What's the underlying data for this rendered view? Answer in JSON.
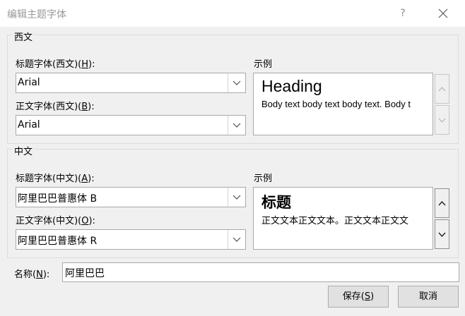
{
  "window": {
    "title": "编辑主题字体",
    "help_label": "?"
  },
  "western": {
    "group_title": "西文",
    "heading_font": {
      "label_before": "标题字体(西文)(",
      "hotkey": "H",
      "label_after": "):",
      "value": "Arial"
    },
    "body_font": {
      "label_before": "正文字体(西文)(",
      "hotkey": "B",
      "label_after": "):",
      "value": "Arial"
    },
    "sample_label": "示例",
    "sample_heading": "Heading",
    "sample_body": "Body text body text body text. Body t"
  },
  "chinese": {
    "group_title": "中文",
    "heading_font": {
      "label_before": "标题字体(中文)(",
      "hotkey": "A",
      "label_after": "):",
      "value": "阿里巴巴普惠体 B"
    },
    "body_font": {
      "label_before": "正文字体(中文)(",
      "hotkey": "O",
      "label_after": "):",
      "value": "阿里巴巴普惠体 R"
    },
    "sample_label": "示例",
    "sample_heading": "标题",
    "sample_body": "正文文本正文文本。正文文本正文文"
  },
  "name": {
    "label_before": "名称(",
    "hotkey": "N",
    "label_after": "):",
    "value": "阿里巴巴"
  },
  "buttons": {
    "save": {
      "label_before": "保存(",
      "hotkey": "S",
      "label_after": ")"
    },
    "cancel": {
      "label": "取消"
    }
  },
  "icons": {
    "close": "close-icon",
    "dropdown": "chevron-down-icon",
    "scroll_up": "chevron-up-icon",
    "scroll_down": "chevron-down-icon"
  }
}
